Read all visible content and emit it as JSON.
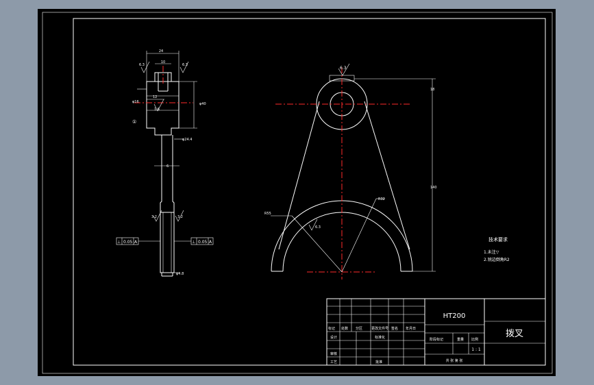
{
  "colors": {
    "viewport_background": "#8d9aa9",
    "sheet": "#000000",
    "line": "#ffffff",
    "centerline": "#ff2a2a"
  },
  "side_view": {
    "top_dim": "24",
    "groove_dim": "10",
    "roughness_top_left": "6.3",
    "roughness_top_right": "6.3",
    "hole_dim": "12",
    "roughness_hole": "1.6",
    "bore_dim": "φ40",
    "left_dim": "φ16",
    "shaft_dim": "φ24.4",
    "web_dim": "6",
    "roughness_lower_left": "3.2",
    "roughness_lower_right": "3.2",
    "bottom_dim": "φ4.8",
    "balloon": "①",
    "tolerance_left": [
      "⊥",
      "0.05",
      "A"
    ],
    "tolerance_right": [
      "⊥",
      "0.05",
      "A"
    ]
  },
  "front_view": {
    "roughness_top": "6.3",
    "dim_top": "18",
    "dim_height": "140",
    "radius_right": "R32",
    "radius_left": "R55",
    "roughness_arc": "6.3"
  },
  "tech_req": {
    "title": "技术要求",
    "items": [
      "1.未注▽",
      "2.锐边倒角R2"
    ]
  },
  "title_block": {
    "material": "HT200",
    "part_name": "拨叉",
    "scale": "1 : 1",
    "header_cells": [
      "标记",
      "处数",
      "分区",
      "更改文件号",
      "签名",
      "年月日"
    ],
    "design": "设计",
    "standardize": "标准化",
    "stage_mark": "阶段标记",
    "weight": "重量",
    "ratio": "比例",
    "review": "审核",
    "process": "工艺",
    "approve": "批准",
    "sheet_info": "共 张 第 张"
  }
}
